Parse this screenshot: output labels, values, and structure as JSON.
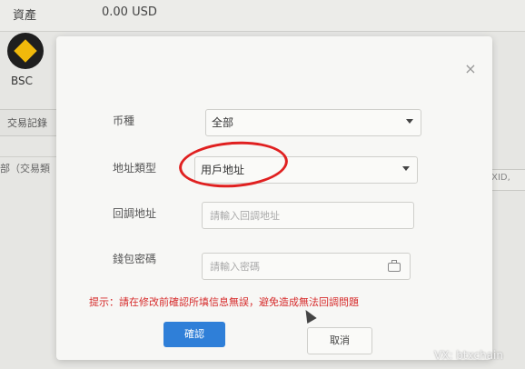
{
  "background": {
    "asset_label": "資產",
    "asset_value": "0.00 USD",
    "coin_name": "BSC",
    "tab_label": "交易記錄",
    "filter_text": "部（交易類",
    "txid_placeholder": "TXID,"
  },
  "modal": {
    "close_symbol": "×",
    "currency_label": "币種",
    "currency_value": "全部",
    "address_type_label": "地址類型",
    "address_type_value": "用戶地址",
    "callback_label": "回調地址",
    "callback_placeholder": "請輸入回調地址",
    "password_label": "錢包密碼",
    "password_placeholder": "請輸入密碼",
    "hint": "提示：請在修改前確認所填信息無誤，避免造成無法回調問題",
    "confirm_label": "確認",
    "cancel_label": "取消"
  },
  "watermark": "VX: btxchain",
  "colors": {
    "primary": "#2f7fd8",
    "hint_red": "#d62b2b",
    "annotation_red": "#e02020"
  },
  "icons": {
    "coin_logo": "bnb-logo-icon",
    "close": "close-icon",
    "dropdown": "chevron-down-icon",
    "password_visibility": "eye-icon"
  }
}
